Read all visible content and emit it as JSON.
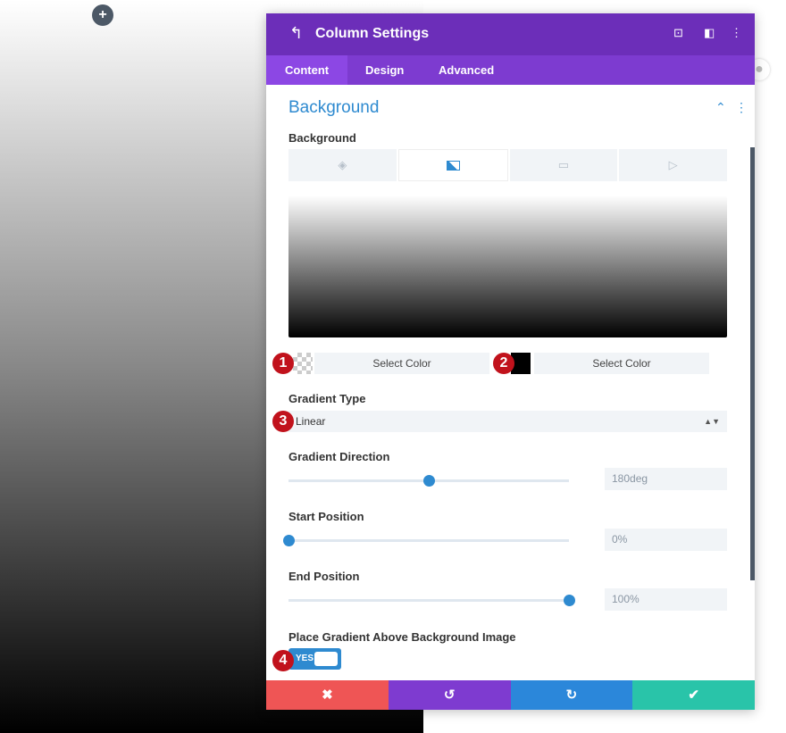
{
  "header": {
    "title": "Column Settings"
  },
  "tabs": [
    {
      "label": "Content"
    },
    {
      "label": "Design"
    },
    {
      "label": "Advanced"
    }
  ],
  "section": {
    "title": "Background"
  },
  "background_label": "Background",
  "background_types": [
    "color",
    "gradient",
    "image",
    "video"
  ],
  "colors": {
    "header": "#6c2eb9",
    "accent": "#2e8ad0",
    "cancel": "#ef5555",
    "undo": "#7e3bd0",
    "redo": "#2b87da",
    "save": "#29c4a9"
  },
  "gradient": {
    "color1": {
      "label": "Select Color",
      "value": "transparent"
    },
    "color2": {
      "label": "Select Color",
      "value": "#000000"
    },
    "type_label": "Gradient Type",
    "type_value": "Linear",
    "direction_label": "Gradient Direction",
    "direction_value": "180deg",
    "direction_deg": 180,
    "start_label": "Start Position",
    "start_value": "0%",
    "start_pct": 0,
    "end_label": "End Position",
    "end_value": "100%",
    "end_pct": 100,
    "above_label": "Place Gradient Above Background Image",
    "above_value": "YES"
  },
  "badges": [
    "1",
    "2",
    "3",
    "4"
  ]
}
